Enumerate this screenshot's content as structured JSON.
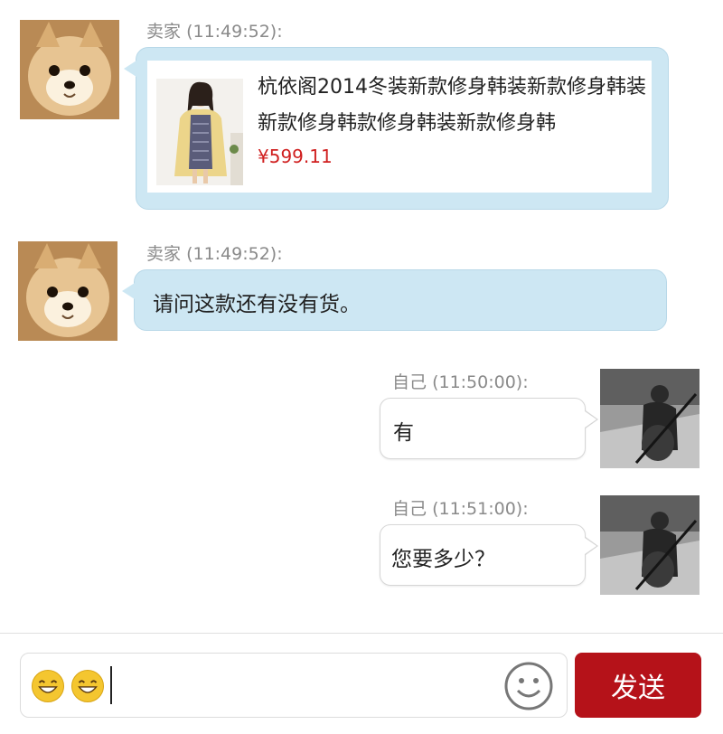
{
  "messages": [
    {
      "sender": "卖家",
      "time": "(11:49:52):",
      "type": "product",
      "product": {
        "title": "杭依阁2014冬装新款修身韩装新款修身韩装新款修身韩款修身韩装新款修身韩",
        "price": "¥599.11"
      }
    },
    {
      "sender": "卖家",
      "time": "(11:49:52):",
      "type": "text",
      "text": "请问这款还有没有货。"
    },
    {
      "sender": "自己",
      "time": "(11:50:00):",
      "type": "text",
      "text": "有"
    },
    {
      "sender": "自己",
      "time": "(11:51:00):",
      "type": "text",
      "text": "您要多少？"
    }
  ],
  "composer": {
    "emojis": [
      "grinning-face-icon",
      "grinning-face-icon"
    ],
    "emoji_picker_icon": "smiley-icon",
    "send_label": "发送"
  },
  "colors": {
    "seller_bubble": "#cde7f3",
    "self_bubble": "#ffffff",
    "price": "#d02020",
    "send_button": "#b51219"
  }
}
